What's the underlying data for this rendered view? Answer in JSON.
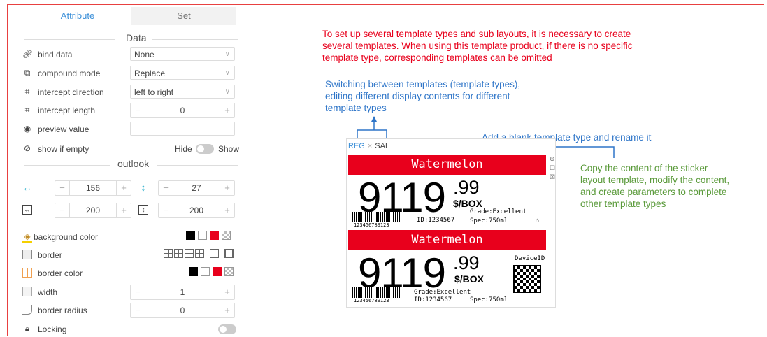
{
  "panel": {
    "tabs": [
      {
        "label": "Attribute"
      },
      {
        "label": "Set"
      }
    ],
    "sections": {
      "data": "Data",
      "outlook": "outlook"
    },
    "rows": {
      "bind_data": {
        "label": "bind data",
        "value": "None"
      },
      "compound_mode": {
        "label": "compound mode",
        "value": "Replace"
      },
      "intercept_direction": {
        "label": "intercept direction",
        "value": "left to right"
      },
      "intercept_length": {
        "label": "intercept length",
        "value": "0"
      },
      "preview_value": {
        "label": "preview value",
        "value": ""
      },
      "show_if_empty": {
        "label": "show if empty",
        "off_label": "Hide",
        "on_label": "Show"
      },
      "width_box": "156",
      "height_box": "27",
      "width2": "200",
      "height2": "200",
      "background_color": {
        "label": "background color"
      },
      "border": {
        "label": "border"
      },
      "border_color": {
        "label": "border color"
      },
      "width": {
        "label": "width",
        "value": "1"
      },
      "border_radius": {
        "label": "border radius",
        "value": "0"
      },
      "locking": {
        "label": "Locking"
      }
    },
    "stepper": {
      "minus": "−",
      "plus": "+"
    },
    "colors": {
      "accent": "#3b8fd8",
      "swatch_red": "#e8001c"
    }
  },
  "annotations": {
    "top_red": [
      "To set up several template types and sub layouts, it is necessary to create",
      "several templates. When using this template product, if there is no specific",
      "template type, corresponding templates can be omitted"
    ],
    "switching": [
      "Switching between templates (template types),",
      "editing different display contents for different",
      "template types"
    ],
    "add_blank": "Add a blank template type and rename it",
    "copy": [
      "Copy the content of the sticker",
      "layout template, modify the content,",
      "and create parameters to complete",
      "other template types"
    ]
  },
  "preview": {
    "tabs": {
      "reg": "REG",
      "close": "×",
      "sal": "SAL"
    },
    "label1": {
      "banner": "Watermelon",
      "price_int": "9119",
      "price_cents": ".99",
      "unit": "$/BOX",
      "grade": "Grade:Excellent",
      "id": "ID:1234567",
      "spec": "Spec:750ml",
      "barcode_num": "123456789123"
    },
    "label2": {
      "banner": "Watermelon",
      "price_int": "9119",
      "price_cents": ".99",
      "unit": "$/BOX",
      "grade": "Grade:Excellent",
      "id": "ID:1234567",
      "spec": "Spec:750ml",
      "barcode_num": "123456789123",
      "device": "DeviceID"
    }
  }
}
